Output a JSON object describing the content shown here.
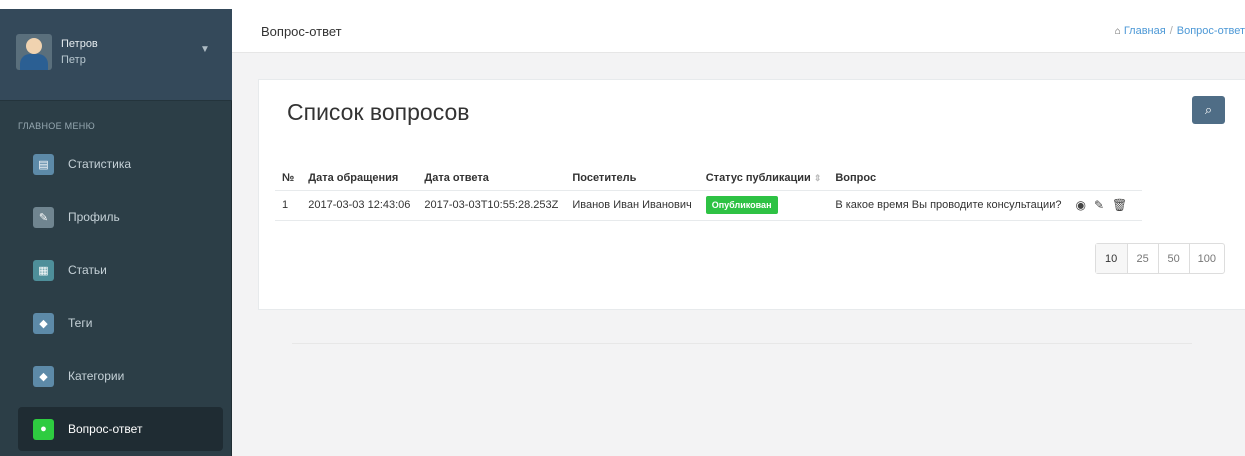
{
  "user": {
    "first": "Петров",
    "last": "Петр"
  },
  "menu": {
    "title": "ГЛАВНОЕ МЕНЮ",
    "items": [
      {
        "label": "Статистика",
        "icon": "list-icon"
      },
      {
        "label": "Профиль",
        "icon": "pencil-icon"
      },
      {
        "label": "Статьи",
        "icon": "newspaper-icon"
      },
      {
        "label": "Теги",
        "icon": "tag-icon"
      },
      {
        "label": "Категории",
        "icon": "tags-icon"
      },
      {
        "label": "Вопрос-ответ",
        "icon": "chat-icon",
        "active": true
      }
    ]
  },
  "header": {
    "title": "Вопрос-ответ",
    "breadcrumb": {
      "home": "Главная",
      "current": "Вопрос-ответ"
    }
  },
  "card": {
    "title": "Список вопросов",
    "table": {
      "columns": [
        "№",
        "Дата обращения",
        "Дата ответа",
        "Посетитель",
        "Статус публикации",
        "Вопрос"
      ],
      "rows": [
        {
          "num": "1",
          "date_request": "2017-03-03 12:43:06",
          "date_answer": "2017-03-03T10:55:28.253Z",
          "visitor": "Иванов Иван Иванович",
          "status": "Опубликован",
          "question": "В какое время Вы проводите консультации?"
        }
      ]
    },
    "page_sizes": [
      "10",
      "25",
      "50",
      "100"
    ]
  },
  "colors": {
    "status_green": "#2ec244",
    "search_button": "#4f6d86",
    "link": "#4c98d6"
  }
}
